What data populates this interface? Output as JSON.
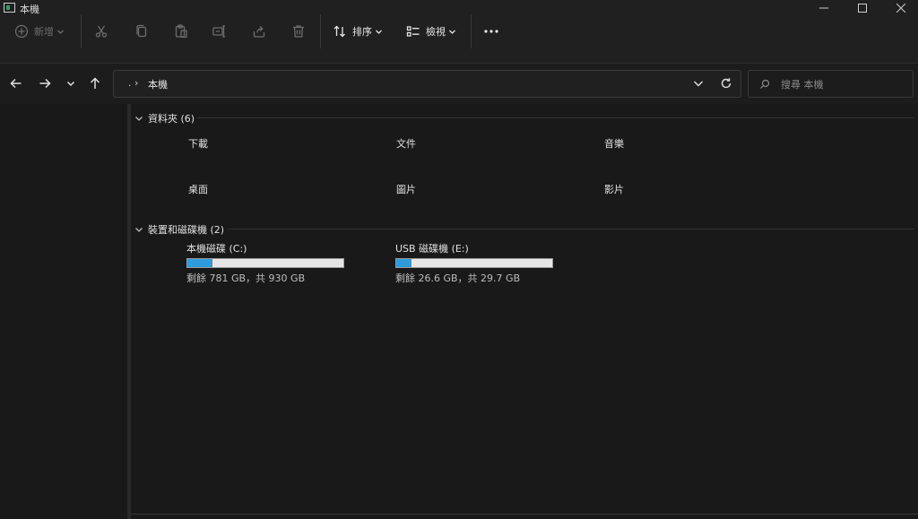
{
  "window": {
    "title": "本機",
    "controls": [
      "minimize-icon",
      "maximize-icon",
      "close-icon"
    ]
  },
  "toolbar": {
    "new_label": "新增",
    "sort_label": "排序",
    "view_label": "檢視",
    "icons": [
      "cut-icon",
      "copy-icon",
      "paste-icon",
      "rename-icon",
      "share-icon",
      "delete-icon",
      "more-icon"
    ]
  },
  "nav": {
    "address_prefix": ". ›",
    "address_location": "本機",
    "search_placeholder": "搜尋 本機"
  },
  "folders_group": {
    "header": "資料夾 (6)",
    "items": [
      "下載",
      "文件",
      "音樂",
      "桌面",
      "圖片",
      "影片"
    ]
  },
  "drives_group": {
    "header": "裝置和磁碟機 (2)",
    "drives": [
      {
        "name": "本機磁碟 (C:)",
        "used_fraction": 0.16,
        "space": "剩餘 781 GB，共 930 GB"
      },
      {
        "name": "USB 磁碟機 (E:)",
        "used_fraction": 0.1,
        "space": "剩餘 26.6 GB，共 29.7 GB"
      }
    ]
  },
  "colors": {
    "background": "#191919",
    "chrome": "#202020",
    "drive_bar_fill": "#2f9bdc"
  }
}
